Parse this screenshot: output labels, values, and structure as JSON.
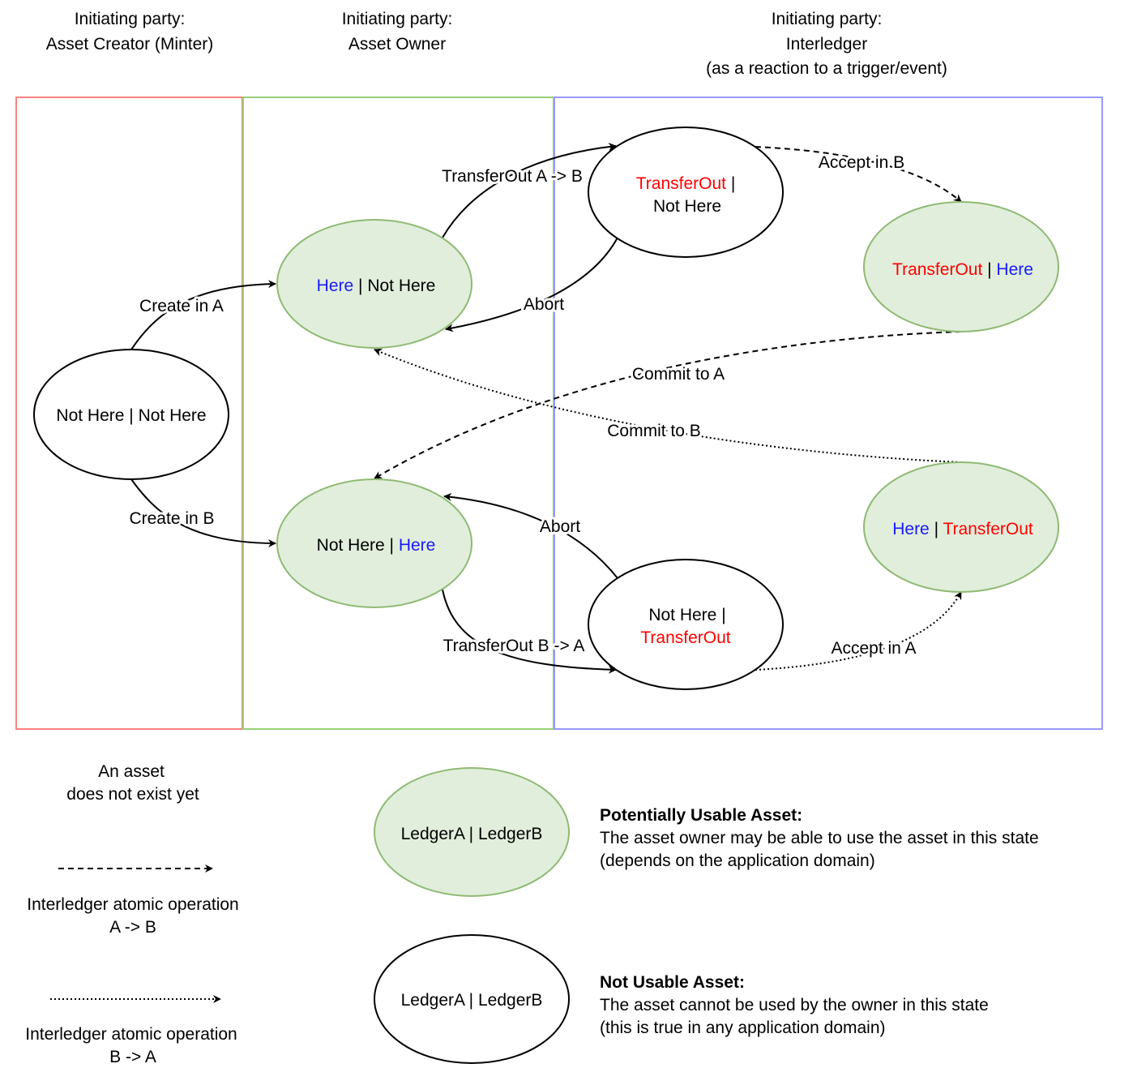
{
  "columns": [
    {
      "line1": "Initiating party:",
      "line2": "Asset Creator (Minter)",
      "border_color": "#ff8080"
    },
    {
      "line1": "Initiating party:",
      "line2": "Asset Owner",
      "border_color": "#97d077"
    },
    {
      "line1": "Initiating party:",
      "line2": "Interledger",
      "line3": "(as a reaction to a trigger/event)",
      "border_color": "#9999ff"
    }
  ],
  "colors": {
    "here": "#1a1aff",
    "transfer_out": "#ff0000",
    "usable_fill": "#e1eedb",
    "usable_stroke": "#8fba74"
  },
  "states": {
    "none": {
      "a": "Not Here",
      "sep": " | ",
      "b": "Not Here"
    },
    "here_a": {
      "a": "Here",
      "sep": " | ",
      "b": "Not Here"
    },
    "here_b": {
      "a": "Not Here",
      "sep": " | ",
      "b": "Here"
    },
    "out_a": {
      "a": "TransferOut",
      "sep": " |",
      "b": "Not Here"
    },
    "out_b": {
      "a": "Not Here |",
      "b": "TransferOut"
    },
    "out_a_here_b": {
      "a": "TransferOut",
      "sep": " | ",
      "b": "Here"
    },
    "here_a_out_b": {
      "a": "Here",
      "sep": " | ",
      "b": "TransferOut"
    }
  },
  "edges": {
    "create_a": "Create in A",
    "create_b": "Create in B",
    "transfer_ab": "TransferOut A -> B",
    "transfer_ba": "TransferOut B -> A",
    "abort_upper": "Abort",
    "abort_lower": "Abort",
    "accept_b": "Accept in B",
    "accept_a": "Accept in A",
    "commit_a": "Commit to A",
    "commit_b": "Commit to B"
  },
  "legend": {
    "no_asset_line1": "An asset",
    "no_asset_line2": "does not exist yet",
    "dashed_line1": "Interledger atomic operation",
    "dashed_line2": "A -> B",
    "dotted_line1": "Interledger atomic operation",
    "dotted_line2": "B -> A",
    "usable_ellipse": "LedgerA | LedgerB",
    "usable_title": "Potentially Usable Asset:",
    "usable_desc1": "The asset owner may be able to use the asset in this state",
    "usable_desc2": "(depends on the application domain)",
    "unusable_ellipse": "LedgerA | LedgerB",
    "unusable_title": "Not Usable Asset:",
    "unusable_desc1": "The asset cannot be used by the owner in this state",
    "unusable_desc2": "(this is true in any application domain)"
  }
}
